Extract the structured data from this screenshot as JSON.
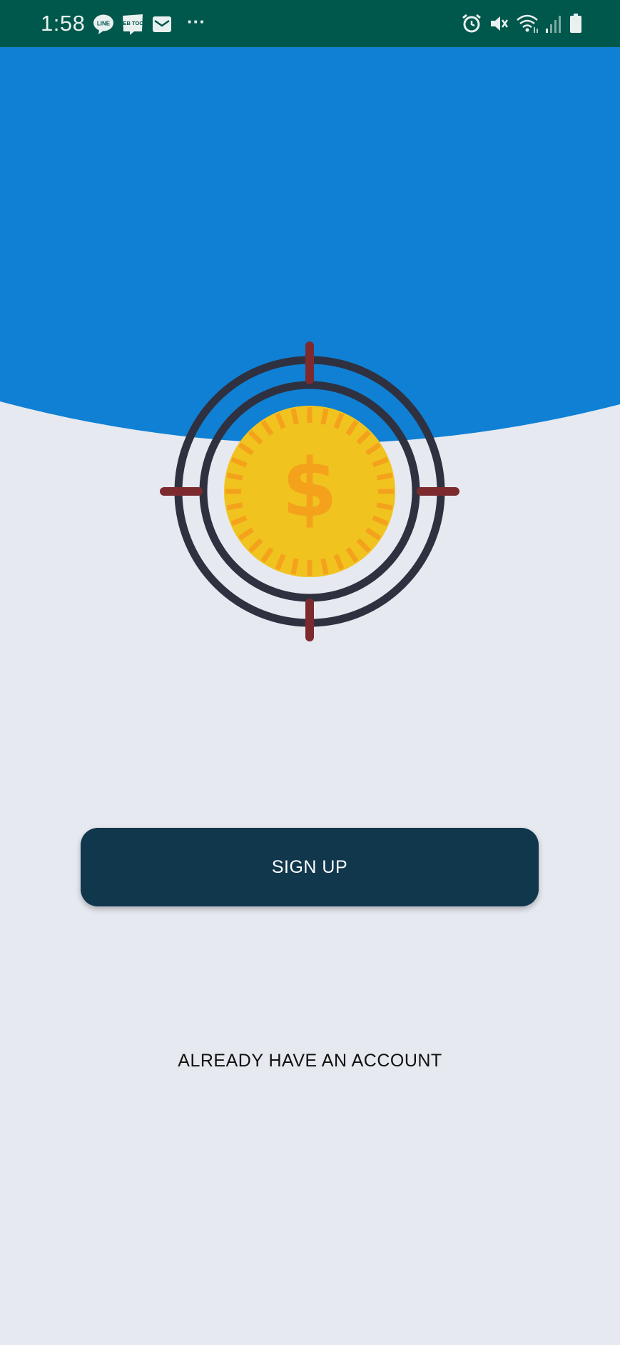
{
  "status_bar": {
    "time": "1:58",
    "notification_icons": [
      "line-icon",
      "webtoon-icon",
      "mail-icon",
      "more-notifications-icon"
    ],
    "system_icons": [
      "alarm-icon",
      "vibrate-icon",
      "wifi-icon",
      "signal-icon",
      "battery-icon"
    ],
    "colors": {
      "background": "#00574b",
      "foreground": "#e8f1ef"
    },
    "line_text": "LINE",
    "webtoon_text": "WEB TOON",
    "more_text": "···"
  },
  "hero": {
    "background_color": "#0f80d3",
    "illustration": "target-coin-icon",
    "coin_symbol": "$",
    "colors": {
      "rings": "#2f3140",
      "crosshair": "#7d2a2f",
      "coin": "#f1c31f",
      "coin_rays": "#f4a21c"
    }
  },
  "actions": {
    "signup_label": "SIGN UP",
    "login_label": "ALREADY HAVE AN ACCOUNT"
  },
  "theme": {
    "page_background": "#e6e9f0",
    "button_color": "#11374d"
  }
}
